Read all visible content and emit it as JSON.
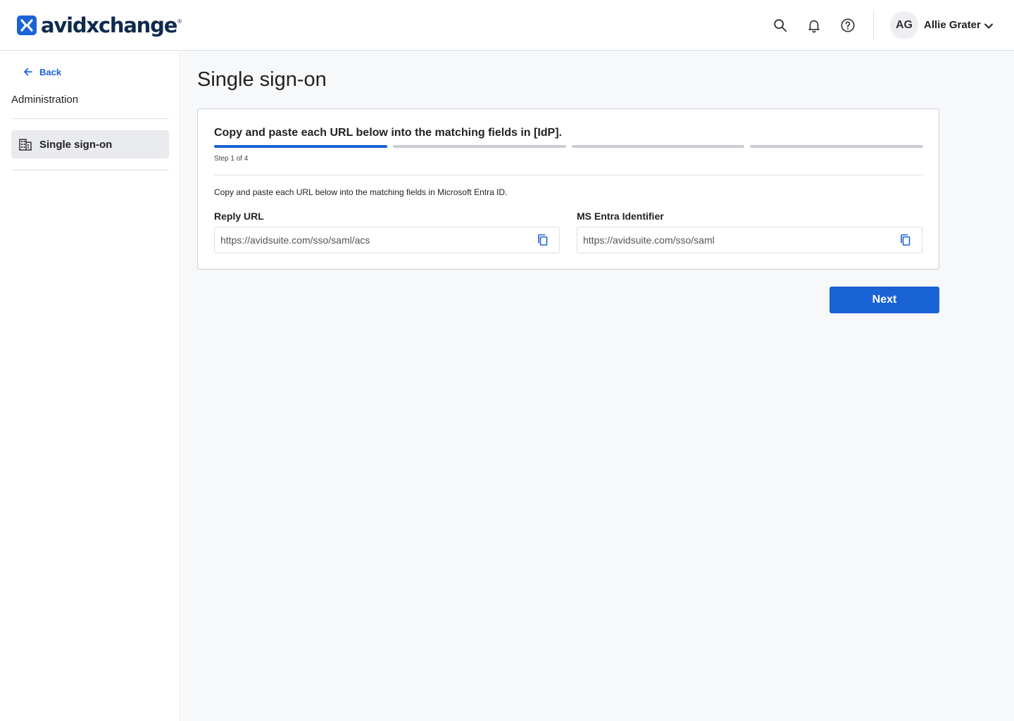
{
  "brand": {
    "name": "avidxchange",
    "registered_mark": "®",
    "accent_color": "#1a63d6",
    "text_color": "#0f2a4f"
  },
  "header": {
    "icons": [
      "search-icon",
      "bell-icon",
      "help-icon"
    ],
    "user": {
      "initials": "AG",
      "name": "Allie Grater"
    }
  },
  "sidebar": {
    "back_label": "Back",
    "heading": "Administration",
    "items": [
      {
        "label": "Single sign-on",
        "icon": "building-icon",
        "active": true
      }
    ]
  },
  "main": {
    "title": "Single sign-on",
    "card": {
      "title": "Copy and paste each URL below into the matching fields in [IdP].",
      "progress": {
        "current_step": 1,
        "total_steps": 4
      },
      "step_label": "Step 1 of 4",
      "instructions": "Copy and paste each URL below into the matching fields in Microsoft Entra ID.",
      "fields": [
        {
          "label": "Reply URL",
          "value": "https://avidsuite.com/sso/saml/acs",
          "copy_icon": "copy-icon"
        },
        {
          "label": "MS Entra Identifier",
          "value": "https://avidsuite.com/sso/saml",
          "copy_icon": "copy-icon"
        }
      ]
    },
    "next_label": "Next"
  }
}
